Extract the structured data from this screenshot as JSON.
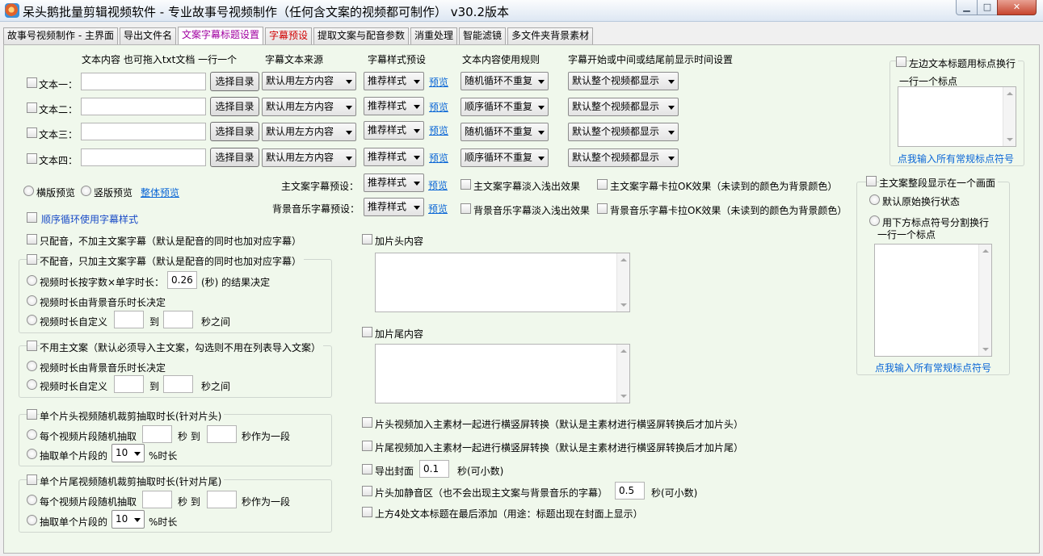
{
  "window": {
    "title": "呆头鹅批量剪辑视频软件 -  专业故事号视频制作（任何含文案的视频都可制作）  v30.2版本",
    "min_glyph": "▁",
    "max_glyph": "□",
    "close_glyph": "✕"
  },
  "tabs": [
    "故事号视频制作 - 主界面",
    "导出文件名",
    "文案字幕标题设置",
    "字幕预设",
    "提取文案与配音参数",
    "消重处理",
    "智能滤镜",
    "多文件夹背景素材"
  ],
  "headers": {
    "content": "文本内容 也可拖入txt文档 一行一个",
    "source": "字幕文本来源",
    "style": "字幕样式预设",
    "rule": "文本内容使用规则",
    "time": "字幕开始或中间或结尾前显示时间设置"
  },
  "rows": [
    {
      "label": "文本一：",
      "value": "",
      "dir_button": "选择目录",
      "source": "默认用左方内容",
      "style": "推荐样式",
      "preview": "预览",
      "rule": "随机循环不重复",
      "time": "默认整个视频都显示"
    },
    {
      "label": "文本二：",
      "value": "",
      "dir_button": "选择目录",
      "source": "默认用左方内容",
      "style": "推荐样式",
      "preview": "预览",
      "rule": "顺序循环不重复",
      "time": "默认整个视频都显示"
    },
    {
      "label": "文本三：",
      "value": "",
      "dir_button": "选择目录",
      "source": "默认用左方内容",
      "style": "推荐样式",
      "preview": "预览",
      "rule": "随机循环不重复",
      "time": "默认整个视频都显示"
    },
    {
      "label": "文本四：",
      "value": "",
      "dir_button": "选择目录",
      "source": "默认用左方内容",
      "style": "推荐样式",
      "preview": "预览",
      "rule": "顺序循环不重复",
      "time": "默认整个视频都显示"
    }
  ],
  "layout_opts": {
    "horizontal": "横版预览",
    "vertical": "竖版预览",
    "overall": "整体预览"
  },
  "main_sub": {
    "label": "主文案字幕预设：",
    "style": "推荐样式",
    "preview": "预览",
    "fade": "主文案字幕淡入浅出效果",
    "karaoke": "主文案字幕卡拉OK效果（未读到的颜色为背景颜色）"
  },
  "bgm_sub": {
    "label": "背景音乐字幕预设：",
    "style": "推荐样式",
    "preview": "预览",
    "fade": "背景音乐字幕淡入浅出效果",
    "karaoke": "背景音乐字幕卡拉OK效果（未读到的颜色为背景颜色）"
  },
  "seq_loop": "顺序循环使用字幕样式",
  "only_dub": "只配音，不加主文案字幕（默认是配音的同时也加对应字幕）",
  "no_dub": {
    "title": "不配音，只加主文案字幕（默认是配音的同时也加对应字幕）",
    "opt1_prefix": "视频时长按字数×单字时长：",
    "opt1_value": "0.26",
    "opt1_suffix": "(秒) 的结果决定",
    "opt2": "视频时长由背景音乐时长决定",
    "opt3_prefix": "视频时长自定义",
    "opt3_to": "到",
    "opt3_suffix": "秒之间"
  },
  "no_main": {
    "title": "不用主文案（默认必须导入主文案，勾选则不用在列表导入文案）",
    "opt1": "视频时长由背景音乐时长决定",
    "opt2_prefix": "视频时长自定义",
    "opt2_to": "到",
    "opt2_suffix": "秒之间"
  },
  "head_clip": {
    "title": "单个片头视频随机裁剪抽取时长(针对片头)",
    "opt1_prefix": "每个视频片段随机抽取",
    "opt1_mid": "秒 到",
    "opt1_suffix": "秒作为一段",
    "opt2_prefix": "抽取单个片段的",
    "opt2_value": "10",
    "opt2_suffix": "%时长"
  },
  "tail_clip": {
    "title": "单个片尾视频随机裁剪抽取时长(针对片尾)",
    "opt1_prefix": "每个视频片段随机抽取",
    "opt1_mid": "秒 到",
    "opt1_suffix": "秒作为一段",
    "opt2_prefix": "抽取单个片段的",
    "opt2_value": "10",
    "opt2_suffix": "%时长"
  },
  "head_content": "加片头内容",
  "tail_content": "加片尾内容",
  "bottom_opts": {
    "head_convert": "片头视频加入主素材一起进行横竖屏转换（默认是主素材进行横竖屏转换后才加片头）",
    "tail_convert": "片尾视频加入主素材一起进行横竖屏转换（默认是主素材进行横竖屏转换后才加片尾）",
    "cover_label": "导出封面",
    "cover_value": "0.1",
    "cover_suffix": "秒(可小数)",
    "silence_label": "片头加静音区（也不会出现主文案与背景音乐的字幕）",
    "silence_value": "0.5",
    "silence_suffix": "秒(可小数)",
    "title_last": "上方4处文本标题在最后添加（用途：标题出现在封面上显示）"
  },
  "right_top": {
    "title": "左边文本标题用标点换行",
    "sub": "一行一个标点",
    "link": "点我输入所有常规标点符号"
  },
  "right_bottom": {
    "title": "主文案整段显示在一个画面",
    "opt1": "默认原始换行状态",
    "opt2_line1": "用下方标点符号分割换行",
    "opt2_line2": "一行一个标点",
    "link": "点我输入所有常规标点符号"
  }
}
